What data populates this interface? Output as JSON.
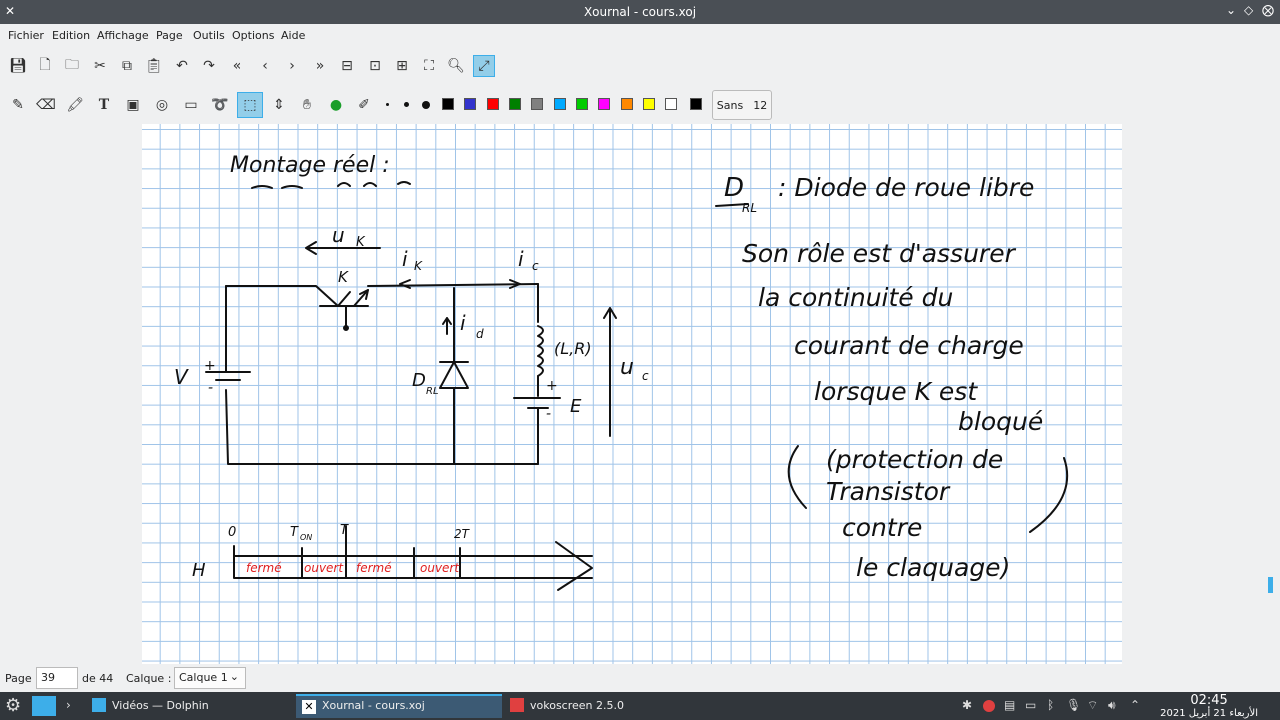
{
  "window": {
    "title": "Xournal - cours.xoj"
  },
  "menu": [
    "Fichier",
    "Edition",
    "Affichage",
    "Page",
    "Outils",
    "Options",
    "Aide"
  ],
  "toolbar": {
    "font_name": "Sans",
    "font_size": "12",
    "colors": [
      "#000000",
      "#3333cc",
      "#ff0000",
      "#008000",
      "#808080",
      "#00aaff",
      "#00cc00",
      "#ff00ff",
      "#ff8800",
      "#ffff00",
      "#ffffff",
      "#000000"
    ]
  },
  "note": {
    "heading": "Montage réel :",
    "circuit_labels": {
      "uk": "u",
      "uk_sub": "K",
      "ik": "i",
      "ik_sub": "K",
      "ic": "i",
      "ic_sub": "c",
      "k": "K",
      "id": "i",
      "id_sub": "d",
      "lr": "(L,R)",
      "uc": "u",
      "uc_sub": "c",
      "v": "V",
      "drl": "D",
      "drl_sub": "RL",
      "e": "E",
      "plus": "+",
      "minus": "-"
    },
    "timeline": {
      "t0": "0",
      "ton": "T",
      "ton_sub": "ON",
      "t": "T",
      "t2": "2T",
      "h": "H",
      "segments": [
        "fermé",
        "ouvert",
        "fermé",
        "ouvert"
      ]
    },
    "right_text": {
      "drl_title": "D",
      "drl_sub": "RL",
      "line1": ": Diode de roue libre",
      "line2": "Son rôle est d'assurer",
      "line3": "la continuité du",
      "line4": "courant de charge",
      "line5": "lorsque K est",
      "line6": "bloqué",
      "line7": "(protection de",
      "line8": "Transistor",
      "line9": "contre",
      "line10": "le claquage)"
    }
  },
  "status": {
    "page_label": "Page",
    "page_value": "39",
    "page_of": "de 44",
    "layer_label": "Calque :",
    "layer_value": "Calque 1"
  },
  "taskbar": {
    "tasks": [
      "Vidéos — Dolphin",
      "Xournal - cours.xoj",
      "vokoscreen 2.5.0"
    ],
    "time": "02:45",
    "date": "الأربعاء 21 أبريل 2021"
  }
}
